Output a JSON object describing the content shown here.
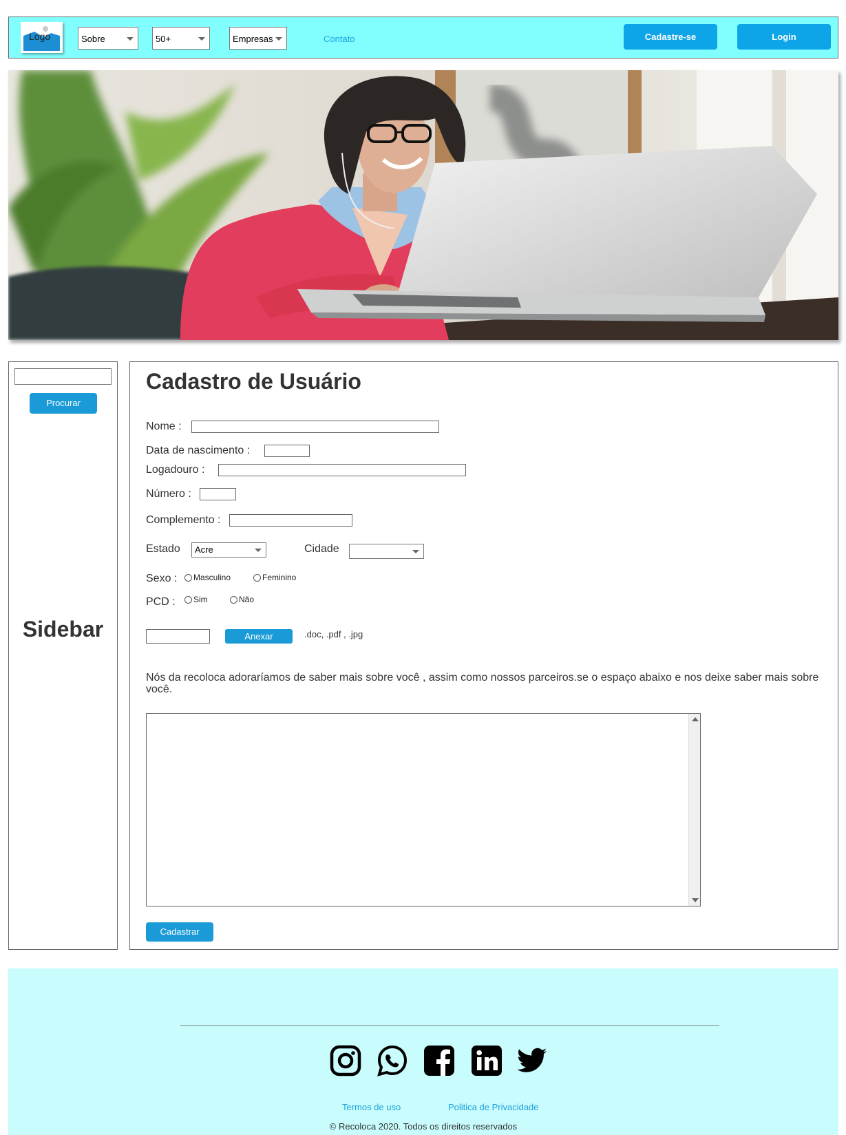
{
  "header": {
    "logo_label": "Logo",
    "menu_selects": [
      "Sobre",
      "50+",
      "Empresas"
    ],
    "contact_link": "Contato",
    "signup_button": "Cadastre-se",
    "login_button": "Login"
  },
  "sidebar": {
    "search_button": "Procurar",
    "label": "Sidebar"
  },
  "form": {
    "title": "Cadastro de Usuário",
    "fields": {
      "name": "Nome :",
      "birthdate": "Data de nascimento  :",
      "street": "Logadouro :",
      "number": "Número :",
      "complement": "Complemento :",
      "state": "Estado",
      "city": "Cidade",
      "sex": "Sexo :",
      "pcd": "PCD :"
    },
    "state_selected": "Acre",
    "city_selected": "",
    "sex_options": [
      "Masculino",
      "Feminino"
    ],
    "pcd_options": [
      "Sim",
      "Não"
    ],
    "attach_button": "Anexar",
    "attach_hint": ".doc, .pdf , .jpg",
    "intro_text": "Nós da recoloca adoraríamos de saber mais sobre você , assim como nossos parceiros.se o espaço abaixo e nos deixe saber mais sobre você.",
    "textarea_value": "",
    "submit_button": "Cadastrar"
  },
  "footer": {
    "social_icons": [
      "instagram-icon",
      "whatsapp-icon",
      "facebook-icon",
      "linkedin-icon",
      "twitter-icon"
    ],
    "terms_link": "Termos de uso",
    "privacy_link": "Politica de Privacidade",
    "copyright": "© Recoloca 2020. Todos os direitos reservados"
  },
  "colors": {
    "header_bg": "#81fffe",
    "footer_bg": "#c8fcfd",
    "button_blue": "#0ea4e8",
    "link_blue": "#1ca1dd"
  }
}
